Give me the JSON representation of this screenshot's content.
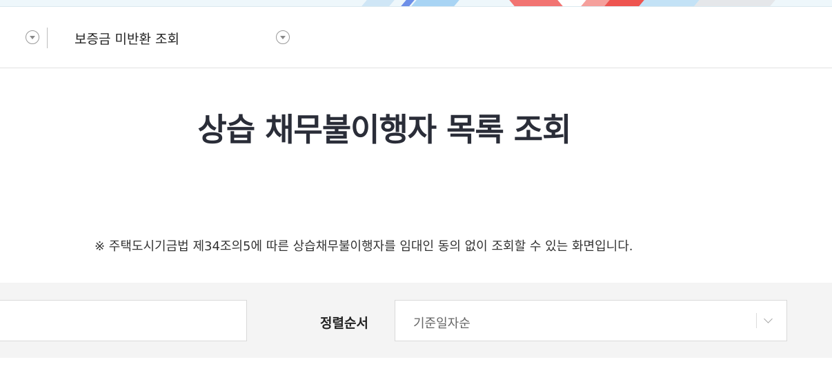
{
  "breadcrumb": {
    "current_label": "보증금 미반환 조회"
  },
  "main": {
    "title": "상습 채무불이행자 목록 조회",
    "notice": "※ 주택도시기금법 제34조의5에 따른 상습채무불이행자를 임대인 동의 없이 조회할 수 있는 화면입니다."
  },
  "filter": {
    "search_value": "",
    "sort_label": "정렬순서",
    "sort_selected": "기준일자순"
  },
  "colors": {
    "title": "#2a2d38",
    "filter_background": "#f4f4f4"
  }
}
